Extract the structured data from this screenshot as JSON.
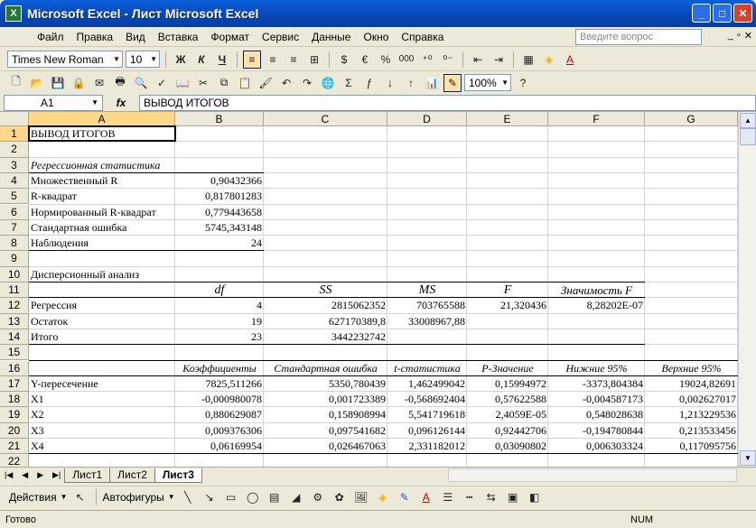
{
  "window": {
    "title": "Microsoft Excel - Лист Microsoft Excel"
  },
  "menu": [
    "Файл",
    "Правка",
    "Вид",
    "Вставка",
    "Формат",
    "Сервис",
    "Данные",
    "Окно",
    "Справка"
  ],
  "help": {
    "placeholder": "Введите вопрос"
  },
  "font": {
    "name": "Times New Roman",
    "size": "10"
  },
  "toolbar": {
    "zoom": "100%",
    "bold": "Ж",
    "italic": "К",
    "underline": "Ч",
    "currency": "€",
    "percent": "%",
    "thousands": "000",
    "sigma": "Σ"
  },
  "formula": {
    "namebox": "A1",
    "fx": "fx",
    "value": "ВЫВОД ИТОГОВ"
  },
  "columns": [
    "A",
    "B",
    "C",
    "D",
    "E",
    "F",
    "G"
  ],
  "rows": [
    "1",
    "2",
    "3",
    "4",
    "5",
    "6",
    "7",
    "8",
    "9",
    "10",
    "11",
    "12",
    "13",
    "14",
    "15",
    "16",
    "17",
    "18",
    "19",
    "20",
    "21",
    "22"
  ],
  "cells": {
    "r1": {
      "a": "ВЫВОД ИТОГОВ"
    },
    "r3": {
      "a": "Регрессионная статистика"
    },
    "r4": {
      "a": "Множественный R",
      "b": "0,90432366"
    },
    "r5": {
      "a": "R-квадрат",
      "b": "0,817801283"
    },
    "r6": {
      "a": "Нормированный R-квадрат",
      "b": "0,779443658"
    },
    "r7": {
      "a": "Стандартная ошибка",
      "b": "5745,343148"
    },
    "r8": {
      "a": "Наблюдения",
      "b": "24"
    },
    "r10": {
      "a": "Дисперсионный анализ"
    },
    "r11": {
      "b": "df",
      "c": "SS",
      "d": "MS",
      "e": "F",
      "f": "Значимость F"
    },
    "r12": {
      "a": "Регрессия",
      "b": "4",
      "c": "2815062352",
      "d": "703765588",
      "e": "21,320436",
      "f": "8,28202E-07"
    },
    "r13": {
      "a": "Остаток",
      "b": "19",
      "c": "627170389,8",
      "d": "33008967,88"
    },
    "r14": {
      "a": "Итого",
      "b": "23",
      "c": "3442232742"
    },
    "r16": {
      "b": "Коэффициенты",
      "c": "Стандартная ошибка",
      "d": "t-статистика",
      "e": "P-Значение",
      "f": "Нижние 95%",
      "g": "Верхние 95%"
    },
    "r17": {
      "a": "Y-пересечение",
      "b": "7825,511266",
      "c": "5350,780439",
      "d": "1,462499042",
      "e": "0,15994972",
      "f": "-3373,804384",
      "g": "19024,82691"
    },
    "r18": {
      "a": "X1",
      "b": "-0,000980078",
      "c": "0,001723389",
      "d": "-0,568692404",
      "e": "0,57622588",
      "f": "-0,004587173",
      "g": "0,002627017"
    },
    "r19": {
      "a": "X2",
      "b": "0,880629087",
      "c": "0,158908994",
      "d": "5,541719618",
      "e": "2,4059E-05",
      "f": "0,548028638",
      "g": "1,213229536"
    },
    "r20": {
      "a": "X3",
      "b": "0,009376306",
      "c": "0,097541682",
      "d": "0,096126144",
      "e": "0,92442706",
      "f": "-0,194780844",
      "g": "0,213533456"
    },
    "r21": {
      "a": "X4",
      "b": "0,06169954",
      "c": "0,026467063",
      "d": "2,331182012",
      "e": "0,03090802",
      "f": "0,006303324",
      "g": "0,117095756"
    }
  },
  "sheets": [
    "Лист1",
    "Лист2",
    "Лист3"
  ],
  "drawing": {
    "actions": "Действия",
    "autoshapes": "Автофигуры"
  },
  "status": {
    "ready": "Готово",
    "num": "NUM"
  }
}
